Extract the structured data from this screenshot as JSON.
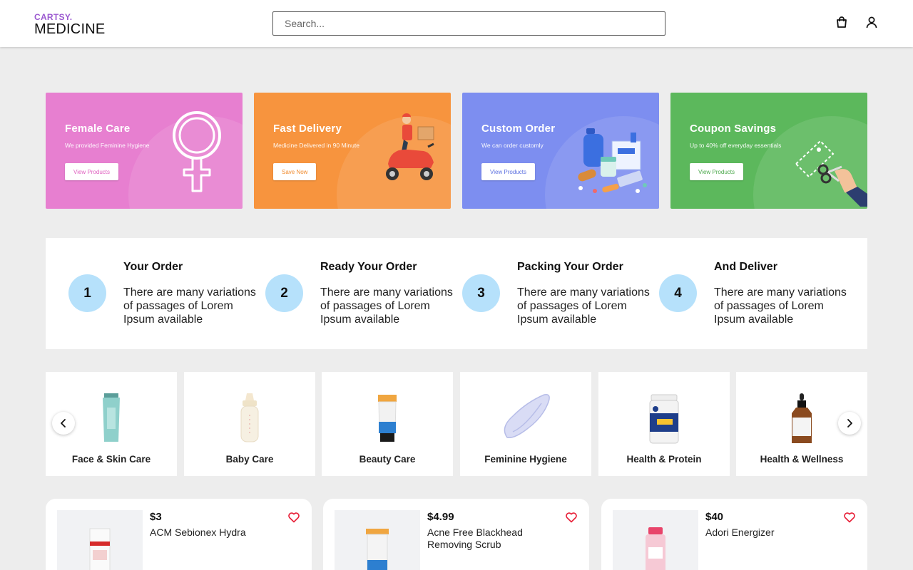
{
  "header": {
    "logo_top": "CARTSY.",
    "logo_bottom": "MEDICINE",
    "search_placeholder": "Search...",
    "icons": [
      "shopping-bag-icon",
      "user-icon"
    ]
  },
  "promos": [
    {
      "title": "Female Care",
      "subtitle": "We provided Feminine Hygiene",
      "button": "View Products",
      "color": "#e77fd0"
    },
    {
      "title": "Fast Delivery",
      "subtitle": "Medicine Delivered in 90 Minute",
      "button": "Save Now",
      "color": "#f7943e"
    },
    {
      "title": "Custom Order",
      "subtitle": "We can order customly",
      "button": "View Products",
      "color": "#7d8ef0"
    },
    {
      "title": "Coupon Savings",
      "subtitle": "Up to 40% off everyday essentials",
      "button": "View Products",
      "color": "#5cb85c"
    }
  ],
  "steps": [
    {
      "number": "1",
      "title": "Your Order",
      "description": "There are many variations of passages of Lorem Ipsum available"
    },
    {
      "number": "2",
      "title": "Ready Your Order",
      "description": "There are many variations of passages of Lorem Ipsum available"
    },
    {
      "number": "3",
      "title": "Packing Your Order",
      "description": "There are many variations of passages of Lorem Ipsum available"
    },
    {
      "number": "4",
      "title": "And Deliver",
      "description": "There are many variations of passages of Lorem Ipsum available"
    }
  ],
  "categories": [
    {
      "label": "Face & Skin Care"
    },
    {
      "label": "Baby Care"
    },
    {
      "label": "Beauty Care"
    },
    {
      "label": "Feminine Hygiene"
    },
    {
      "label": "Health & Protein"
    },
    {
      "label": "Health & Wellness"
    }
  ],
  "products": [
    {
      "price": "$3",
      "name": "ACM Sebionex Hydra"
    },
    {
      "price": "$4.99",
      "name": "Acne Free Blackhead Removing Scrub"
    },
    {
      "price": "$40",
      "name": "Adori Energizer"
    }
  ]
}
